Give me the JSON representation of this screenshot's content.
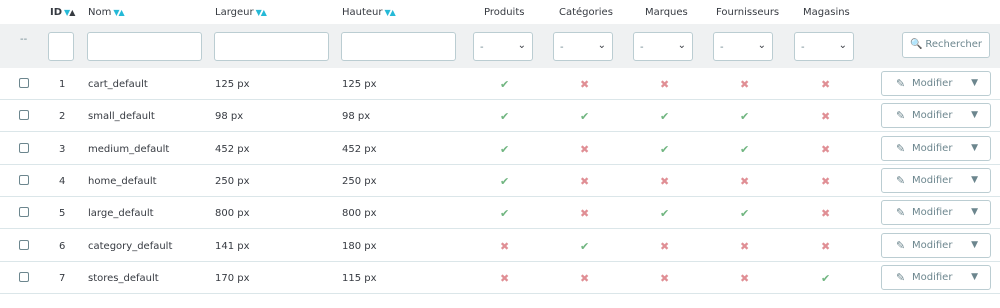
{
  "columns": {
    "id": "ID",
    "name": "Nom",
    "width": "Largeur",
    "height": "Hauteur",
    "products": "Produits",
    "categories": "Catégories",
    "brands": "Marques",
    "suppliers": "Fournisseurs",
    "stores": "Magasins"
  },
  "sort_arrows": {
    "down": "▼",
    "up": "▲"
  },
  "filters": {
    "dashes": "--",
    "select_value": "-",
    "chevron": "⌄",
    "search_label": "Rechercher",
    "search_icon": "🔍"
  },
  "row_action": {
    "label": "Modifier",
    "dropdown": "▼",
    "edit_icon": "✎"
  },
  "marks": {
    "yes": "✔",
    "no": "✖"
  },
  "rows": [
    {
      "id": "1",
      "name": "cart_default",
      "width": "125 px",
      "height": "125 px",
      "products": true,
      "categories": false,
      "brands": false,
      "suppliers": false,
      "stores": false
    },
    {
      "id": "2",
      "name": "small_default",
      "width": "98 px",
      "height": "98 px",
      "products": true,
      "categories": true,
      "brands": true,
      "suppliers": true,
      "stores": false
    },
    {
      "id": "3",
      "name": "medium_default",
      "width": "452 px",
      "height": "452 px",
      "products": true,
      "categories": false,
      "brands": true,
      "suppliers": true,
      "stores": false
    },
    {
      "id": "4",
      "name": "home_default",
      "width": "250 px",
      "height": "250 px",
      "products": true,
      "categories": false,
      "brands": false,
      "suppliers": false,
      "stores": false
    },
    {
      "id": "5",
      "name": "large_default",
      "width": "800 px",
      "height": "800 px",
      "products": true,
      "categories": false,
      "brands": true,
      "suppliers": true,
      "stores": false
    },
    {
      "id": "6",
      "name": "category_default",
      "width": "141 px",
      "height": "180 px",
      "products": false,
      "categories": true,
      "brands": false,
      "suppliers": false,
      "stores": false
    },
    {
      "id": "7",
      "name": "stores_default",
      "width": "170 px",
      "height": "115 px",
      "products": false,
      "categories": false,
      "brands": false,
      "suppliers": false,
      "stores": true
    }
  ],
  "colors": {
    "accent": "#25b9d7",
    "yes": "#70b580",
    "no": "#e08f95",
    "filter_bg": "#eff1f2"
  }
}
